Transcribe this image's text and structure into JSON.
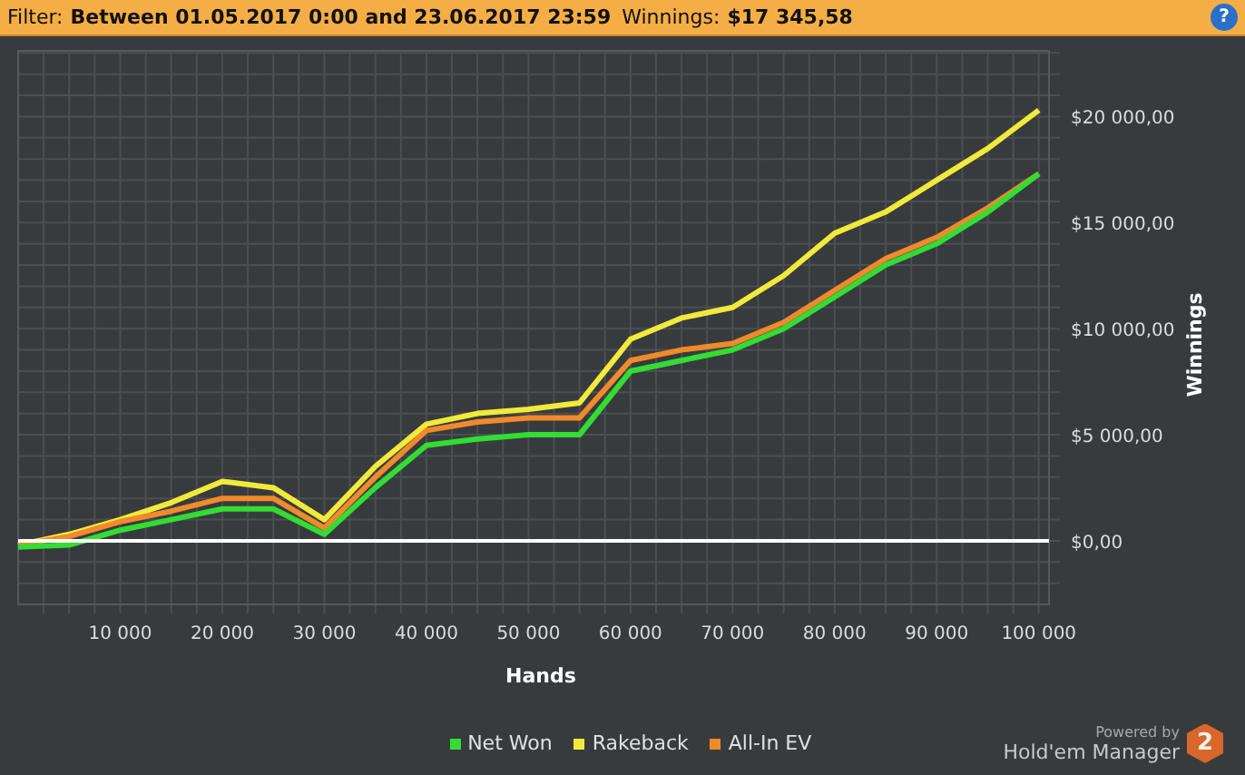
{
  "filter_bar": {
    "filter_label": "Filter:",
    "filter_value": "Between 01.05.2017 0:00 and 23.06.2017 23:59",
    "winnings_label": "Winnings:",
    "winnings_value": "$17 345,58",
    "help": "?"
  },
  "chart": {
    "chart_data": {
      "type": "line",
      "xlabel": "Hands",
      "ylabel": "Winnings",
      "x": [
        0,
        5000,
        10000,
        15000,
        20000,
        25000,
        30000,
        35000,
        40000,
        45000,
        50000,
        55000,
        60000,
        65000,
        70000,
        75000,
        80000,
        85000,
        90000,
        95000,
        100000
      ],
      "series": [
        {
          "name": "Net Won",
          "color": "#33dd33",
          "values": [
            -300,
            -200,
            500,
            1000,
            1500,
            1500,
            300,
            2500,
            4500,
            4800,
            5000,
            5000,
            8000,
            8500,
            9000,
            10000,
            11500,
            13000,
            14000,
            15500,
            17300
          ]
        },
        {
          "name": "Rakeback",
          "color": "#f2ea3a",
          "values": [
            -200,
            300,
            1000,
            1800,
            2800,
            2500,
            1000,
            3500,
            5500,
            6000,
            6200,
            6500,
            9500,
            10500,
            11000,
            12500,
            14500,
            15500,
            17000,
            18500,
            20300
          ]
        },
        {
          "name": "All-In EV",
          "color": "#f08a2a",
          "values": [
            -200,
            200,
            900,
            1400,
            2000,
            2000,
            600,
            3000,
            5200,
            5600,
            5800,
            5800,
            8500,
            9000,
            9300,
            10300,
            11800,
            13300,
            14300,
            15700,
            17300
          ]
        }
      ],
      "xlim": [
        0,
        101000
      ],
      "grid": true,
      "ylim": [
        -3000,
        23100
      ],
      "xticks": [
        {
          "value": 10000,
          "label": "10 000"
        },
        {
          "value": 20000,
          "label": "20 000"
        },
        {
          "value": 30000,
          "label": "30 000"
        },
        {
          "value": 40000,
          "label": "40 000"
        },
        {
          "value": 50000,
          "label": "50 000"
        },
        {
          "value": 60000,
          "label": "60 000"
        },
        {
          "value": 70000,
          "label": "70 000"
        },
        {
          "value": 80000,
          "label": "80 000"
        },
        {
          "value": 90000,
          "label": "90 000"
        },
        {
          "value": 100000,
          "label": "100 000"
        }
      ],
      "yticks": [
        {
          "value": 0,
          "label": "$0,00"
        },
        {
          "value": 5000,
          "label": "$5 000,00"
        },
        {
          "value": 10000,
          "label": "$10 000,00"
        },
        {
          "value": 15000,
          "label": "$15 000,00"
        },
        {
          "value": 20000,
          "label": "$20 000,00"
        }
      ]
    }
  },
  "branding": {
    "powered_by": "Powered by",
    "product": "Hold'em Manager",
    "badge": "2"
  }
}
